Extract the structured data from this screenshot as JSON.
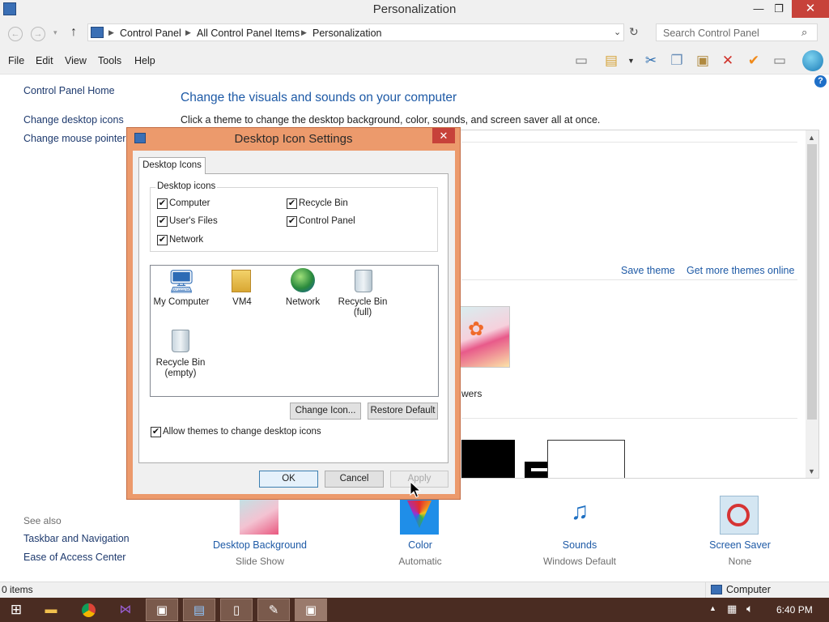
{
  "window": {
    "title": "Personalization"
  },
  "address": {
    "crumbs": [
      "Control Panel",
      "All Control Panel Items",
      "Personalization"
    ],
    "search_placeholder": "Search Control Panel"
  },
  "menu": [
    "File",
    "Edit",
    "View",
    "Tools",
    "Help"
  ],
  "left_pane": {
    "links": [
      "Control Panel Home",
      "Change desktop icons",
      "Change mouse pointers"
    ],
    "see_also_title": "See also",
    "see_also": [
      "Taskbar and Navigation",
      "Ease of Access Center"
    ]
  },
  "main": {
    "heading": "Change the visuals and sounds on your computer",
    "description": "Click a theme to change the desktop background, color, sounds, and screen saver all at once.",
    "save_theme": "Save theme",
    "get_more": "Get more themes online",
    "theme_name_fragment": "wers"
  },
  "bottom": [
    {
      "label": "Desktop Background",
      "sub": "Slide Show"
    },
    {
      "label": "Color",
      "sub": "Automatic"
    },
    {
      "label": "Sounds",
      "sub": "Windows Default"
    },
    {
      "label": "Screen Saver",
      "sub": "None"
    }
  ],
  "status": {
    "items": "0 items",
    "computer": "Computer"
  },
  "taskbar": {
    "time": "6:40 PM"
  },
  "dialog": {
    "title": "Desktop Icon Settings",
    "tab": "Desktop Icons",
    "group_title": "Desktop icons",
    "checkboxes": {
      "computer": {
        "label": "Computer",
        "checked": true
      },
      "recycle_bin": {
        "label": "Recycle Bin",
        "checked": true
      },
      "users_files": {
        "label": "User's Files",
        "checked": true
      },
      "control_panel": {
        "label": "Control Panel",
        "checked": true
      },
      "network": {
        "label": "Network",
        "checked": true
      }
    },
    "icons": [
      {
        "label": "My Computer"
      },
      {
        "label": "VM4"
      },
      {
        "label": "Network"
      },
      {
        "label": "Recycle Bin\n(full)"
      },
      {
        "label": "Recycle Bin\n(empty)"
      }
    ],
    "change_icon": "Change Icon...",
    "restore_default": "Restore Default",
    "allow_themes": "Allow themes to change desktop icons",
    "ok": "OK",
    "cancel": "Cancel",
    "apply": "Apply"
  },
  "colors": {
    "link": "#1e5aa6",
    "dialog_frame": "#ec9a6c",
    "taskbar": "#4a2c22",
    "close_red": "#c7423a"
  }
}
